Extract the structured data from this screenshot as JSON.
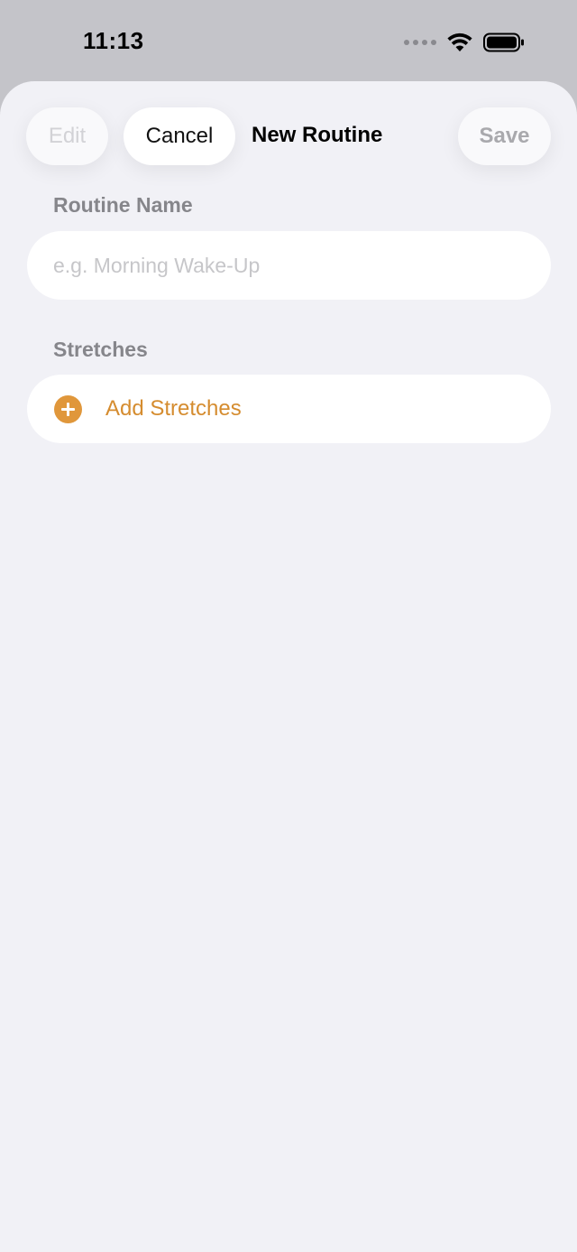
{
  "status_bar": {
    "time": "11:13",
    "icons": [
      "cellular-signal-icon",
      "wifi-icon",
      "battery-icon"
    ]
  },
  "nav": {
    "edit_label": "Edit",
    "cancel_label": "Cancel",
    "title": "New Routine",
    "save_label": "Save"
  },
  "form": {
    "name_section_label": "Routine Name",
    "name_placeholder": "e.g. Morning Wake-Up",
    "name_value": "",
    "stretches_section_label": "Stretches",
    "add_stretches_label": "Add Stretches"
  },
  "colors": {
    "accent": "#d58c2f",
    "accent_icon": "#e0973b",
    "sheet_background": "#f1f1f6",
    "secondary_text": "#86868b"
  }
}
